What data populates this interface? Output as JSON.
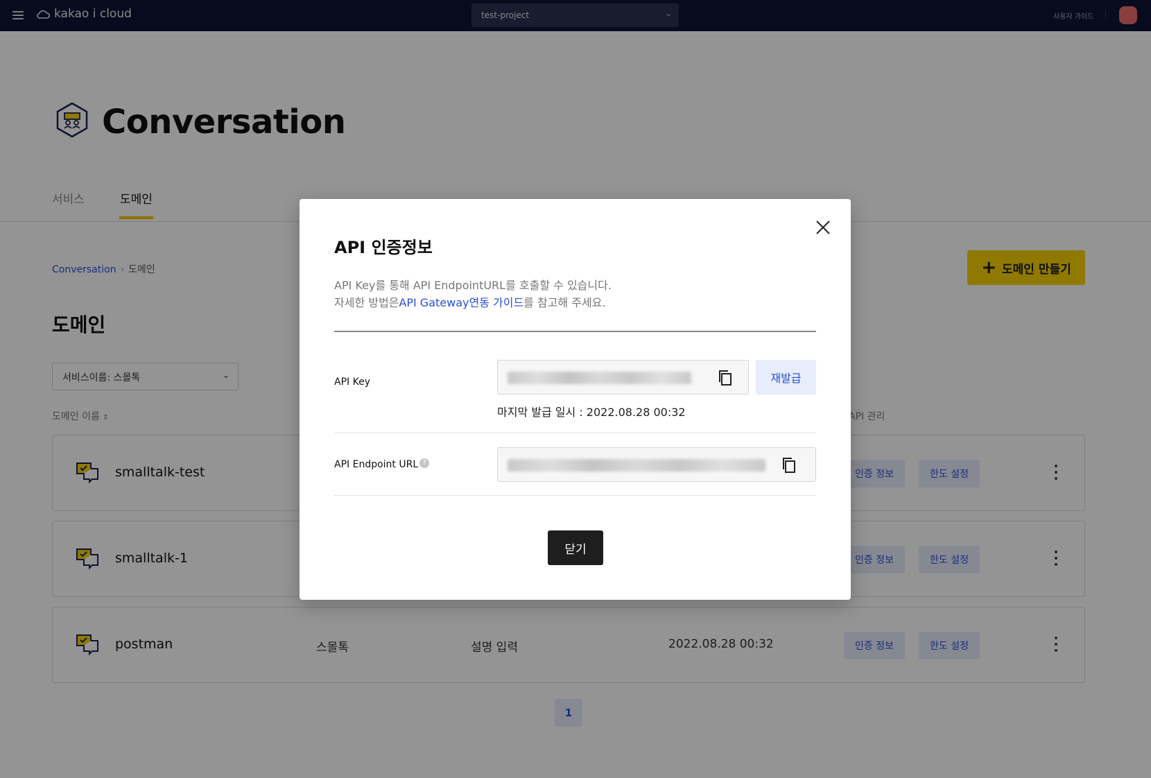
{
  "topbar": {
    "brand": "kakao i cloud",
    "project": "test-project",
    "user_guide": "사용자 가이드"
  },
  "page": {
    "title": "Conversation",
    "tabs": [
      {
        "label": "서비스",
        "active": false
      },
      {
        "label": "도메인",
        "active": true
      }
    ],
    "breadcrumb": {
      "root": "Conversation",
      "current": "도메인"
    },
    "create_button": "도메인 만들기",
    "section_title": "도메인",
    "filter": "서비스이름: 스몰톡",
    "columns": {
      "name": "도메인 이름",
      "api": "API 관리"
    },
    "rows": [
      {
        "name": "smalltalk-test",
        "service": "",
        "description": "",
        "date": "",
        "auth": "인증 정보",
        "limit": "한도 설정"
      },
      {
        "name": "smalltalk-1",
        "service": "",
        "description": "",
        "date": "",
        "auth": "인증 정보",
        "limit": "한도 설정"
      },
      {
        "name": "postman",
        "service": "스몰톡",
        "description": "설명 입력",
        "date": "2022.08.28 00:32",
        "auth": "인증 정보",
        "limit": "한도 설정"
      }
    ],
    "page_number": "1"
  },
  "modal": {
    "title": "API 인증정보",
    "desc_line1": "API Key를 통해 API EndpointURL를 호출할 수 있습니다.",
    "desc_prefix": "자세한 방법은",
    "desc_link": "API Gateway연동 가이드",
    "desc_suffix": "를 참고해 주세요.",
    "api_key_label": "API Key",
    "reissue_button": "재발급",
    "last_issued": "마지막 발급 일시 : 2022.08.28 00:32",
    "endpoint_label": "API Endpoint URL",
    "help_mark": "?",
    "close_button": "닫기"
  },
  "colors": {
    "topbar": "#0b1433",
    "accent_yellow": "#f7d000",
    "link_blue": "#2a4fd6",
    "soft_blue": "#e8edfb"
  }
}
